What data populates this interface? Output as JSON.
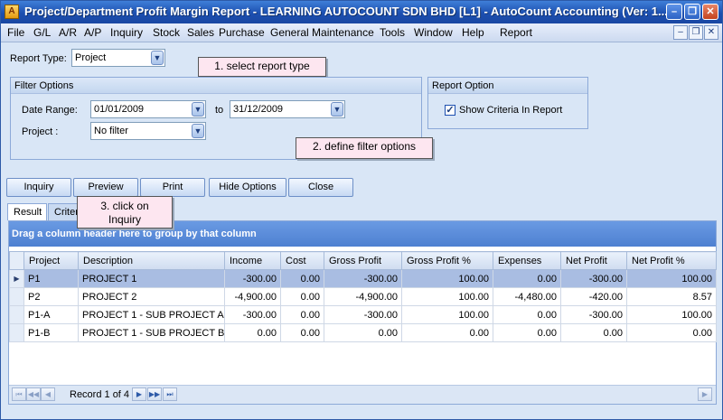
{
  "window": {
    "title": "Project/Department Profit Margin Report - LEARNING AUTOCOUNT SDN BHD [L1] - AutoCount Accounting (Ver: 1...",
    "app_icon_label": "A",
    "minimize_glyph": "–",
    "restore_glyph": "❐",
    "close_glyph": "✕"
  },
  "menu": {
    "items": [
      "File",
      "G/L",
      "A/R",
      "A/P",
      "Inquiry",
      "Stock",
      "Sales",
      "Purchase",
      "General Maintenance",
      "Tools",
      "Window",
      "Help",
      "Report"
    ],
    "controls": [
      "–",
      "❐",
      "✕"
    ]
  },
  "report_type": {
    "label": "Report Type:",
    "value": "Project"
  },
  "filter_options": {
    "title": "Filter Options",
    "date_range_label": "Date Range:",
    "date_from": "01/01/2009",
    "to_label": "to",
    "date_to": "31/12/2009",
    "project_label": "Project :",
    "project_value": "No filter"
  },
  "report_option": {
    "title": "Report Option",
    "show_criteria_label": "Show Criteria In Report",
    "show_criteria_checked": true,
    "check_glyph": "✓"
  },
  "callouts": {
    "step1": "1. select report type",
    "step2": "2. define filter options",
    "step3_line1": "3. click on",
    "step3_line2": "Inquiry"
  },
  "buttons": {
    "inquiry": "Inquiry",
    "preview": "Preview",
    "print": "Print",
    "hide_options": "Hide Options",
    "close": "Close"
  },
  "tabs": {
    "result": "Result",
    "criteria": "Criter"
  },
  "grid": {
    "group_hint": "Drag a column header here to group by that column",
    "columns": [
      "Project",
      "Description",
      "Income",
      "Cost",
      "Gross Profit",
      "Gross Profit %",
      "Expenses",
      "Net Profit",
      "Net Profit %"
    ],
    "rows": [
      [
        "P1",
        "PROJECT 1",
        "-300.00",
        "0.00",
        "-300.00",
        "100.00",
        "0.00",
        "-300.00",
        "100.00"
      ],
      [
        "P2",
        "PROJECT 2",
        "-4,900.00",
        "0.00",
        "-4,900.00",
        "100.00",
        "-4,480.00",
        "-420.00",
        "8.57"
      ],
      [
        "P1-A",
        "PROJECT 1 - SUB PROJECT A",
        "-300.00",
        "0.00",
        "-300.00",
        "100.00",
        "0.00",
        "-300.00",
        "100.00"
      ],
      [
        "P1-B",
        "PROJECT 1 - SUB PROJECT B",
        "0.00",
        "0.00",
        "0.00",
        "0.00",
        "0.00",
        "0.00",
        "0.00"
      ]
    ],
    "selected_row_marker": "▶"
  },
  "navigator": {
    "record_text": "Record 1 of 4",
    "glyphs": {
      "first": "⏮",
      "prev_page": "◀◀",
      "prev": "◀",
      "next": "▶",
      "next_page": "▶▶",
      "last": "⏭",
      "scroll_right": "▶"
    }
  },
  "colors": {
    "titlebar": "#1c4fb0",
    "group_bar": "#5a8cda",
    "selected_row": "#a9bde2",
    "callout": "#fde6f0"
  }
}
